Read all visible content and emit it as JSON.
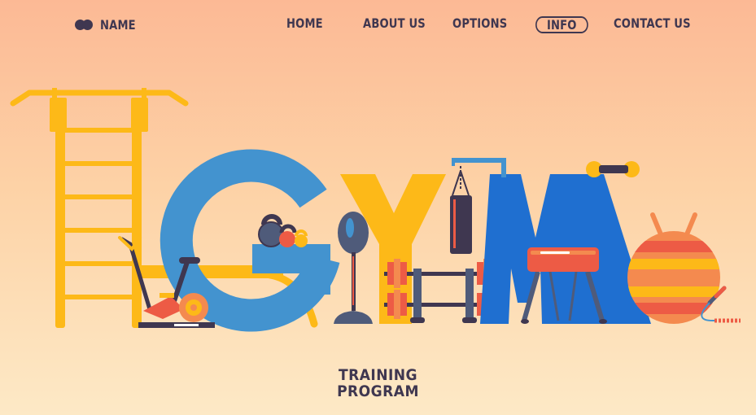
{
  "nav": {
    "brand": "NAME",
    "items": [
      {
        "label": "HOME"
      },
      {
        "label": "ABOUT US"
      },
      {
        "label": "OPTIONS"
      },
      {
        "label": "INFO",
        "active": true
      },
      {
        "label": "CONTACT US"
      }
    ]
  },
  "hero": {
    "tagline_line1": "TRAINING",
    "tagline_line2": "PROGRAM"
  },
  "colors": {
    "text": "#3f3750",
    "yellow": "#fdb918",
    "blue_g": "#4393cf",
    "blue_m": "#1f6fd0",
    "red": "#ed5b45",
    "orange": "#f48a4f"
  },
  "icons": [
    "logo-mark-icon",
    "wall-bars-icon",
    "exercise-bike-icon",
    "kettlebell-icon",
    "speed-bag-icon",
    "punching-bag-icon",
    "dumbbell-icon",
    "vaulting-horse-icon",
    "fitness-ball-icon",
    "jump-rope-icon"
  ]
}
